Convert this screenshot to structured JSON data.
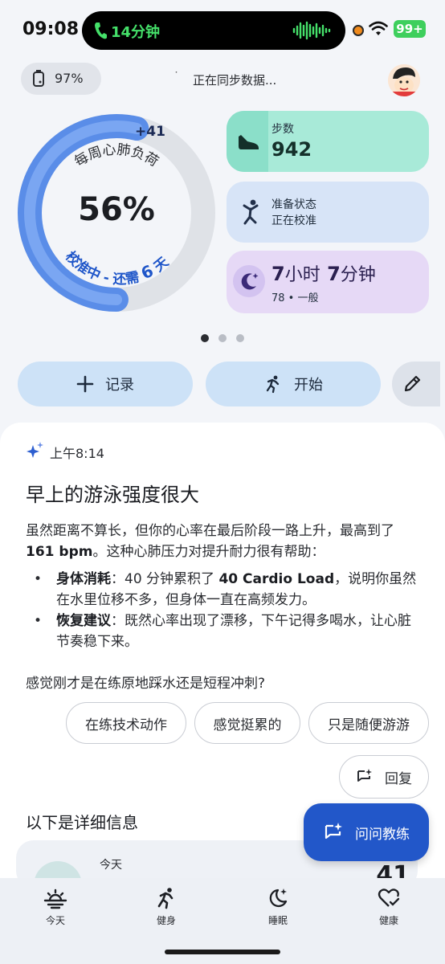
{
  "status_bar": {
    "time": "09:08",
    "call_duration": "14分钟",
    "battery": "99+"
  },
  "sync": {
    "watch_battery": "97%",
    "message": "正在同步数据..."
  },
  "ring": {
    "label": "每周心肺负荷",
    "percent": "56%",
    "delta": "+41",
    "calibration_prefix": "校准中 - 还需",
    "calibration_days": "6",
    "calibration_unit": "天",
    "progress": 0.56
  },
  "metrics": {
    "steps": {
      "label": "步数",
      "value": "942"
    },
    "readiness": {
      "label": "准备状态",
      "value": "正在校准"
    },
    "sleep": {
      "hours": "7",
      "hours_unit": "小时",
      "minutes": "7",
      "minutes_unit": "分钟",
      "score": "78",
      "quality": "一般"
    }
  },
  "pager": {
    "count": 3,
    "active": 0
  },
  "actions": {
    "record": "记录",
    "start": "开始"
  },
  "insight": {
    "time": "上午8:14",
    "title": "早上的游泳强度很大",
    "body_1": "虽然距离不算长，但你的心率在最后阶段一路上升，最高到了 ",
    "body_bold": "161 bpm",
    "body_2": "。这种心肺压力对提升耐力很有帮助：",
    "bullets": [
      {
        "head": "身体消耗",
        "text_1": "：40 分钟累积了 ",
        "bold": "40 Cardio Load",
        "text_2": "，说明你虽然在水里位移不多，但身体一直在高频发力。"
      },
      {
        "head": "恢复建议",
        "text_1": "：既然心率出现了漂移，下午记得多喝水，让心脏节奏稳下来。",
        "bold": "",
        "text_2": ""
      }
    ],
    "question": "感觉刚才是在练原地踩水还是短程冲刺?",
    "chips": [
      "在练技术动作",
      "感觉挺累的",
      "只是随便游游"
    ],
    "reply": "回复"
  },
  "details": {
    "title": "以下是详细信息",
    "card_label": "今天",
    "card_number": "41"
  },
  "coach_button": "问问教练",
  "nav": [
    {
      "label": "今天",
      "icon": "sunrise-icon"
    },
    {
      "label": "健身",
      "icon": "running-icon"
    },
    {
      "label": "睡眠",
      "icon": "moon-star-icon"
    },
    {
      "label": "健康",
      "icon": "heart-check-icon"
    }
  ]
}
